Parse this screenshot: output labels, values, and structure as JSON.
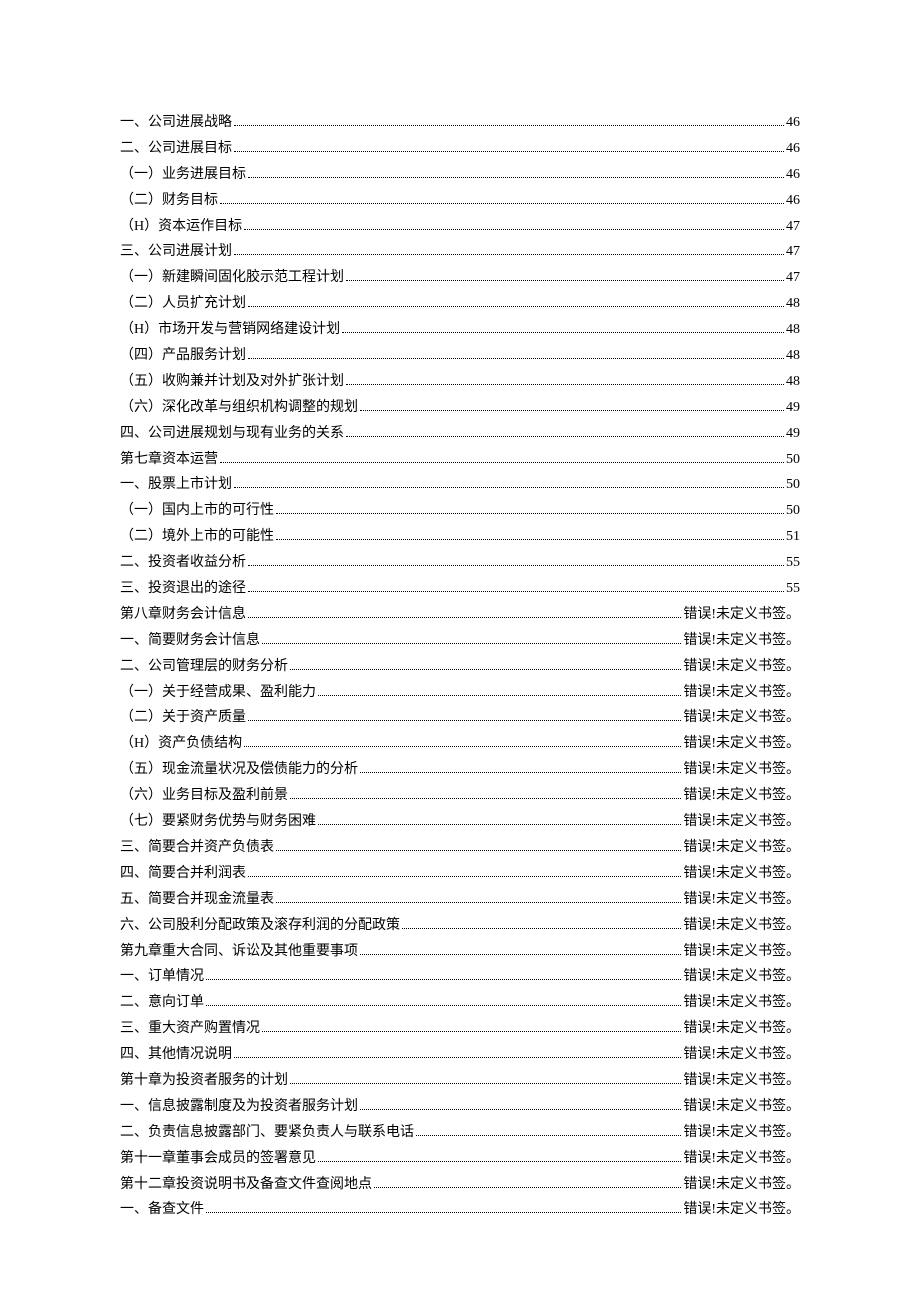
{
  "toc": [
    {
      "label": "一、公司进展战略",
      "page": "46"
    },
    {
      "label": "二、公司进展目标",
      "page": "46"
    },
    {
      "label": "（一）业务进展目标",
      "page": "46"
    },
    {
      "label": "（二）财务目标",
      "page": "46"
    },
    {
      "label": "（H）资本运作目标",
      "page": "47"
    },
    {
      "label": "三、公司进展计划",
      "page": "47"
    },
    {
      "label": "（一）新建瞬间固化胶示范工程计划",
      "page": "47"
    },
    {
      "label": "（二）人员扩充计划",
      "page": "48"
    },
    {
      "label": "（H）市场开发与营销网络建设计划",
      "page": "48"
    },
    {
      "label": "（四）产品服务计划",
      "page": "48"
    },
    {
      "label": "（五）收购兼并计划及对外扩张计划",
      "page": "48"
    },
    {
      "label": "（六）深化改革与组织机构调整的规划",
      "page": "49"
    },
    {
      "label": "四、公司进展规划与现有业务的关系",
      "page": "49"
    },
    {
      "label": "第七章资本运营",
      "page": "50"
    },
    {
      "label": "一、股票上市计划",
      "page": "50"
    },
    {
      "label": "（一）国内上市的可行性",
      "page": "50"
    },
    {
      "label": "（二）境外上市的可能性",
      "page": "51"
    },
    {
      "label": "二、投资者收益分析",
      "page": "55"
    },
    {
      "label": "三、投资退出的途径",
      "page": "55"
    },
    {
      "label": "第八章财务会计信息",
      "page": "错误!未定义书签。"
    },
    {
      "label": "一、简要财务会计信息",
      "page": "错误!未定义书签。"
    },
    {
      "label": "二、公司管理层的财务分析",
      "page": "错误!未定义书签。"
    },
    {
      "label": "（一）关于经营成果、盈利能力",
      "page": "错误!未定义书签。"
    },
    {
      "label": "（二）关于资产质量",
      "page": "错误!未定义书签。"
    },
    {
      "label": "（H）资产负债结构",
      "page": "错误!未定义书签。"
    },
    {
      "label": "（五）现金流量状况及偿债能力的分析",
      "page": "错误!未定义书签。"
    },
    {
      "label": "（六）业务目标及盈利前景",
      "page": "错误!未定义书签。"
    },
    {
      "label": "（七）要紧财务优势与财务困难",
      "page": "错误!未定义书签。"
    },
    {
      "label": "三、简要合并资产负债表",
      "page": "错误!未定义书签。"
    },
    {
      "label": "四、简要合并利润表",
      "page": "错误!未定义书签。"
    },
    {
      "label": "五、简要合并现金流量表",
      "page": "错误!未定义书签。"
    },
    {
      "label": "六、公司股利分配政策及滚存利润的分配政策",
      "page": "错误!未定义书签。"
    },
    {
      "label": "第九章重大合同、诉讼及其他重要事项",
      "page": "错误!未定义书签。"
    },
    {
      "label": "一、订单情况",
      "page": "错误!未定义书签。"
    },
    {
      "label": "二、意向订单",
      "page": "错误!未定义书签。"
    },
    {
      "label": "三、重大资产购置情况",
      "page": "错误!未定义书签。"
    },
    {
      "label": "四、其他情况说明",
      "page": "错误!未定义书签。"
    },
    {
      "label": "第十章为投资者服务的计划",
      "page": "错误!未定义书签。"
    },
    {
      "label": "一、信息披露制度及为投资者服务计划",
      "page": "错误!未定义书签。"
    },
    {
      "label": "二、负责信息披露部门、要紧负责人与联系电话",
      "page": "错误!未定义书签。"
    },
    {
      "label": "第十一章董事会成员的签署意见",
      "page": "错误!未定义书签。"
    },
    {
      "label": "第十二章投资说明书及备查文件查阅地点",
      "page": "错误!未定义书签。"
    },
    {
      "label": "一、备查文件",
      "page": "错误!未定义书签。"
    }
  ]
}
